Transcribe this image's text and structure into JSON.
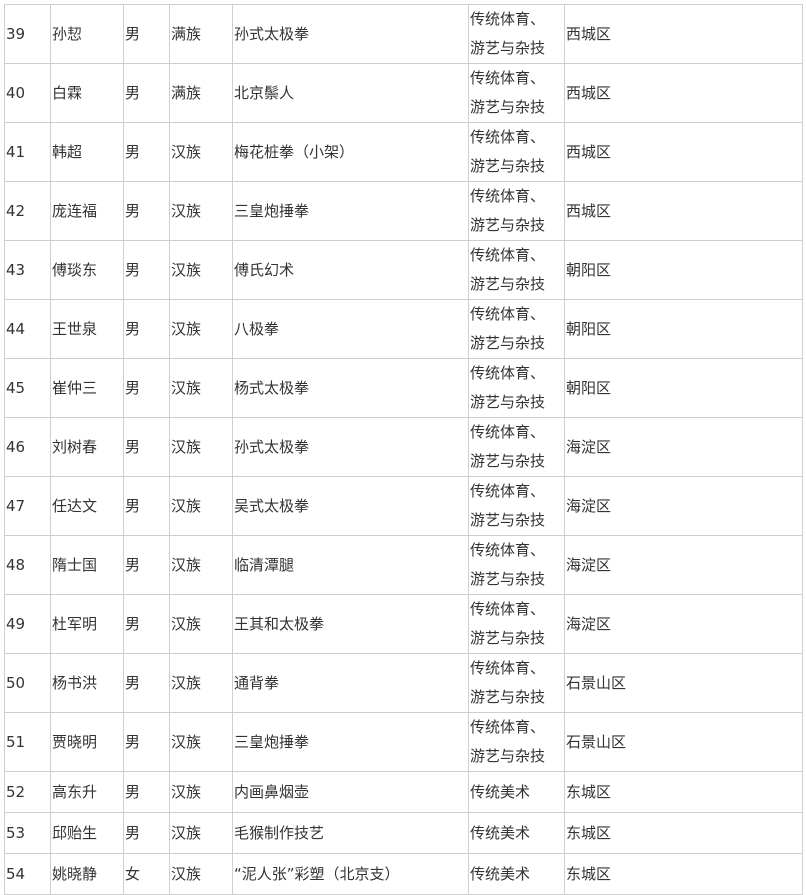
{
  "table": {
    "rows": [
      {
        "no": "39",
        "name": "孙恝",
        "gender": "男",
        "ethnicity": "满族",
        "item": "孙式太极拳",
        "category": [
          "传统体育、",
          "游艺与杂技"
        ],
        "district": "西城区"
      },
      {
        "no": "40",
        "name": "白霖",
        "gender": "男",
        "ethnicity": "满族",
        "item": "北京鬃人",
        "category": [
          "传统体育、",
          "游艺与杂技"
        ],
        "district": "西城区"
      },
      {
        "no": "41",
        "name": "韩超",
        "gender": "男",
        "ethnicity": "汉族",
        "item": "梅花桩拳（小架）",
        "category": [
          "传统体育、",
          "游艺与杂技"
        ],
        "district": "西城区"
      },
      {
        "no": "42",
        "name": "庞连福",
        "gender": "男",
        "ethnicity": "汉族",
        "item": "三皇炮捶拳",
        "category": [
          "传统体育、",
          "游艺与杂技"
        ],
        "district": "西城区"
      },
      {
        "no": "43",
        "name": "傅琰东",
        "gender": "男",
        "ethnicity": "汉族",
        "item": "傅氏幻术",
        "category": [
          "传统体育、",
          "游艺与杂技"
        ],
        "district": "朝阳区"
      },
      {
        "no": "44",
        "name": "王世泉",
        "gender": "男",
        "ethnicity": "汉族",
        "item": "八极拳",
        "category": [
          "传统体育、",
          "游艺与杂技"
        ],
        "district": "朝阳区"
      },
      {
        "no": "45",
        "name": "崔仲三",
        "gender": "男",
        "ethnicity": "汉族",
        "item": "杨式太极拳",
        "category": [
          "传统体育、",
          "游艺与杂技"
        ],
        "district": "朝阳区"
      },
      {
        "no": "46",
        "name": "刘树春",
        "gender": "男",
        "ethnicity": "汉族",
        "item": "孙式太极拳",
        "category": [
          "传统体育、",
          "游艺与杂技"
        ],
        "district": "海淀区"
      },
      {
        "no": "47",
        "name": "任达文",
        "gender": "男",
        "ethnicity": "汉族",
        "item": "吴式太极拳",
        "category": [
          "传统体育、",
          "游艺与杂技"
        ],
        "district": "海淀区"
      },
      {
        "no": "48",
        "name": "隋士国",
        "gender": "男",
        "ethnicity": "汉族",
        "item": "临清潭腿",
        "category": [
          "传统体育、",
          "游艺与杂技"
        ],
        "district": "海淀区"
      },
      {
        "no": "49",
        "name": "杜军明",
        "gender": "男",
        "ethnicity": "汉族",
        "item": "王其和太极拳",
        "category": [
          "传统体育、",
          "游艺与杂技"
        ],
        "district": "海淀区"
      },
      {
        "no": "50",
        "name": "杨书洪",
        "gender": "男",
        "ethnicity": "汉族",
        "item": "通背拳",
        "category": [
          "传统体育、",
          "游艺与杂技"
        ],
        "district": "石景山区"
      },
      {
        "no": "51",
        "name": "贾晓明",
        "gender": "男",
        "ethnicity": "汉族",
        "item": "三皇炮捶拳",
        "category": [
          "传统体育、",
          "游艺与杂技"
        ],
        "district": "石景山区"
      },
      {
        "no": "52",
        "name": "高东升",
        "gender": "男",
        "ethnicity": "汉族",
        "item": "内画鼻烟壶",
        "category": [
          "传统美术"
        ],
        "district": "东城区"
      },
      {
        "no": "53",
        "name": "邱贻生",
        "gender": "男",
        "ethnicity": "汉族",
        "item": "毛猴制作技艺",
        "category": [
          "传统美术"
        ],
        "district": "东城区"
      },
      {
        "no": "54",
        "name": "姚晓静",
        "gender": "女",
        "ethnicity": "汉族",
        "item": "“泥人张”彩塑（北京支）",
        "category": [
          "传统美术"
        ],
        "district": "东城区"
      }
    ]
  }
}
